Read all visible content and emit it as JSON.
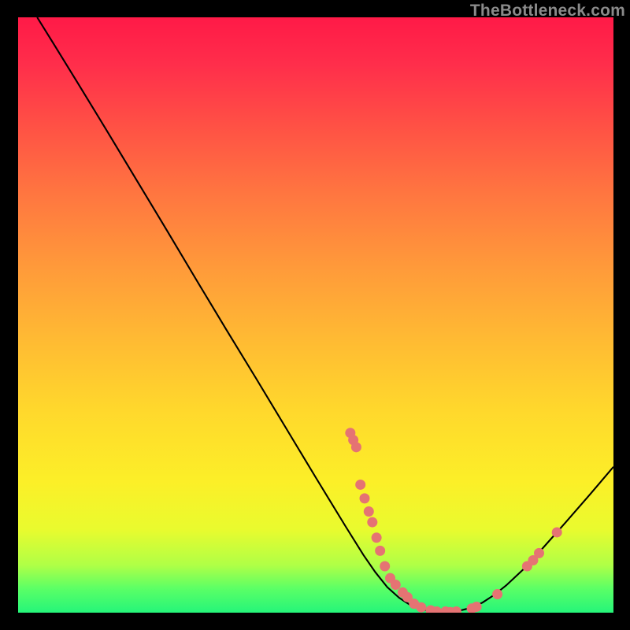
{
  "watermark": "TheBottleneck.com",
  "colors": {
    "background": "#000000",
    "curve": "#000000",
    "points": "#e57373",
    "gradient_top": "#ff1a47",
    "gradient_bottom": "#25f57a"
  },
  "chart_data": {
    "type": "line",
    "title": "",
    "xlabel": "",
    "ylabel": "",
    "xlim": [
      0,
      100
    ],
    "ylim": [
      0,
      100
    ],
    "grid": false,
    "curve": [
      {
        "x": 3.2,
        "y": 100.0
      },
      {
        "x": 6.0,
        "y": 95.5
      },
      {
        "x": 10.0,
        "y": 89.0
      },
      {
        "x": 15.0,
        "y": 80.8
      },
      {
        "x": 20.0,
        "y": 72.5
      },
      {
        "x": 25.0,
        "y": 64.2
      },
      {
        "x": 30.0,
        "y": 55.8
      },
      {
        "x": 35.0,
        "y": 47.5
      },
      {
        "x": 40.0,
        "y": 39.3
      },
      {
        "x": 45.0,
        "y": 31.0
      },
      {
        "x": 50.0,
        "y": 22.7
      },
      {
        "x": 55.0,
        "y": 14.5
      },
      {
        "x": 58.0,
        "y": 9.7
      },
      {
        "x": 60.0,
        "y": 6.8
      },
      {
        "x": 62.0,
        "y": 4.3
      },
      {
        "x": 64.0,
        "y": 2.5
      },
      {
        "x": 66.0,
        "y": 1.2
      },
      {
        "x": 68.0,
        "y": 0.5
      },
      {
        "x": 70.0,
        "y": 0.2
      },
      {
        "x": 72.0,
        "y": 0.1
      },
      {
        "x": 74.0,
        "y": 0.3
      },
      {
        "x": 76.0,
        "y": 0.8
      },
      {
        "x": 78.0,
        "y": 1.7
      },
      {
        "x": 80.0,
        "y": 3.0
      },
      {
        "x": 82.0,
        "y": 4.6
      },
      {
        "x": 85.0,
        "y": 7.4
      },
      {
        "x": 88.0,
        "y": 10.7
      },
      {
        "x": 92.0,
        "y": 15.2
      },
      {
        "x": 96.0,
        "y": 19.8
      },
      {
        "x": 100.0,
        "y": 24.5
      }
    ],
    "series": [
      {
        "name": "data-points",
        "type": "scatter",
        "marker_radius": 6.5,
        "points": [
          {
            "x": 55.8,
            "y": 30.2
          },
          {
            "x": 56.3,
            "y": 29.0
          },
          {
            "x": 56.8,
            "y": 27.8
          },
          {
            "x": 57.5,
            "y": 21.5
          },
          {
            "x": 58.2,
            "y": 19.2
          },
          {
            "x": 58.9,
            "y": 17.0
          },
          {
            "x": 59.5,
            "y": 15.2
          },
          {
            "x": 60.2,
            "y": 12.6
          },
          {
            "x": 60.8,
            "y": 10.4
          },
          {
            "x": 61.6,
            "y": 7.8
          },
          {
            "x": 62.5,
            "y": 5.8
          },
          {
            "x": 63.4,
            "y": 4.7
          },
          {
            "x": 64.6,
            "y": 3.4
          },
          {
            "x": 65.4,
            "y": 2.6
          },
          {
            "x": 66.5,
            "y": 1.5
          },
          {
            "x": 67.7,
            "y": 0.9
          },
          {
            "x": 69.3,
            "y": 0.4
          },
          {
            "x": 70.3,
            "y": 0.2
          },
          {
            "x": 71.8,
            "y": 0.2
          },
          {
            "x": 72.6,
            "y": 0.1
          },
          {
            "x": 73.6,
            "y": 0.2
          },
          {
            "x": 76.2,
            "y": 0.7
          },
          {
            "x": 77.0,
            "y": 1.0
          },
          {
            "x": 80.5,
            "y": 3.1
          },
          {
            "x": 85.5,
            "y": 7.8
          },
          {
            "x": 86.5,
            "y": 8.8
          },
          {
            "x": 87.5,
            "y": 10.0
          },
          {
            "x": 90.5,
            "y": 13.5
          }
        ]
      }
    ]
  }
}
